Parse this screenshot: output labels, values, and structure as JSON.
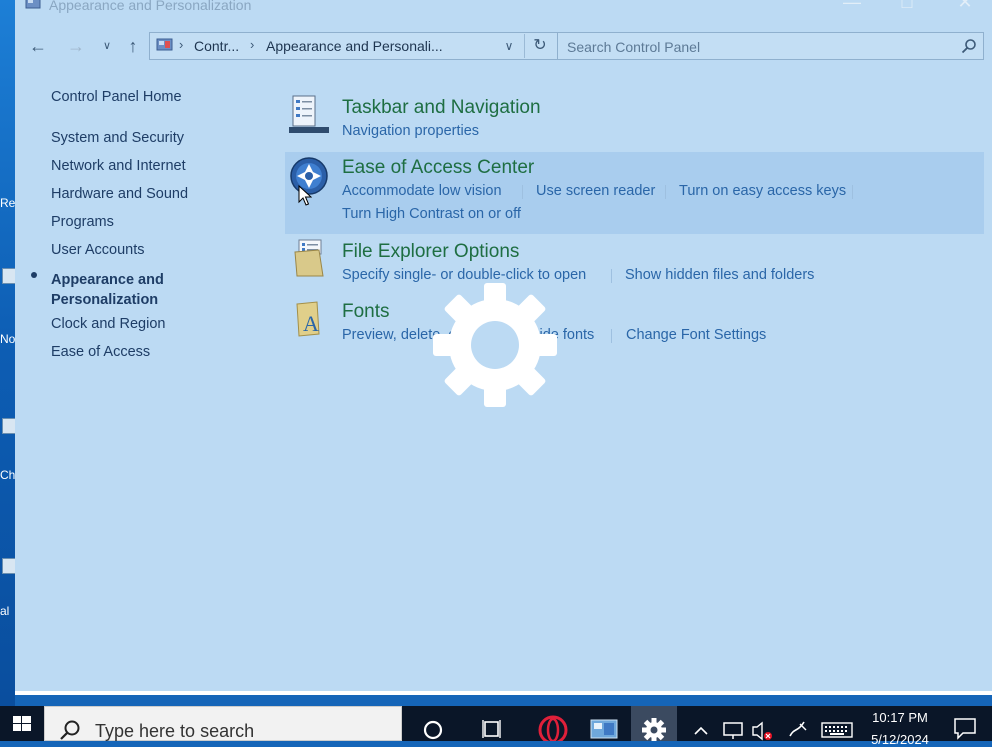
{
  "window": {
    "title": "Appearance and Personalization",
    "minimize_glyph": "—",
    "maximize_glyph": "□",
    "close_glyph": "✕"
  },
  "navigation": {
    "back_glyph": "←",
    "forward_glyph": "→",
    "recent_glyph": "∨",
    "up_glyph": "↑"
  },
  "address": {
    "crumbs": [
      "Contr...",
      "Appearance and Personali..."
    ],
    "separator": "›",
    "dropdown_glyph": "∨",
    "refresh_glyph": "↻"
  },
  "search": {
    "placeholder": "Search Control Panel"
  },
  "left_nav": {
    "home": "Control Panel Home",
    "items": [
      "System and Security",
      "Network and Internet",
      "Hardware and Sound",
      "Programs",
      "User Accounts"
    ],
    "current": "Appearance and Personalization",
    "items_after": [
      "Clock and Region",
      "Ease of Access"
    ]
  },
  "categories": [
    {
      "title": "Taskbar and Navigation",
      "icon": "taskbar-icon",
      "tasks": [
        "Navigation properties"
      ]
    },
    {
      "title": "Ease of Access Center",
      "icon": "ease-of-access-icon",
      "tasks": [
        "Accommodate low vision",
        "Use screen reader",
        "Turn on easy access keys",
        "Turn High Contrast on or off"
      ]
    },
    {
      "title": "File Explorer Options",
      "icon": "folder-options-icon",
      "tasks": [
        "Specify single- or double-click to open",
        "Show hidden files and folders"
      ]
    },
    {
      "title": "Fonts",
      "icon": "fonts-icon",
      "tasks": [
        "Preview, delete, or show and hide fonts",
        "Change Font Settings"
      ]
    }
  ],
  "desktop": {
    "fragments": [
      "Re",
      "No",
      "Ch",
      "al"
    ]
  },
  "taskbar": {
    "search_placeholder": "Type here to search",
    "time": "10:17 PM",
    "date": "5/12/2024"
  },
  "colors": {
    "window_bg": "#bcdaf3",
    "link": "#2a66a8",
    "category_title": "#1e6e42",
    "taskbar": "#0a1628"
  }
}
